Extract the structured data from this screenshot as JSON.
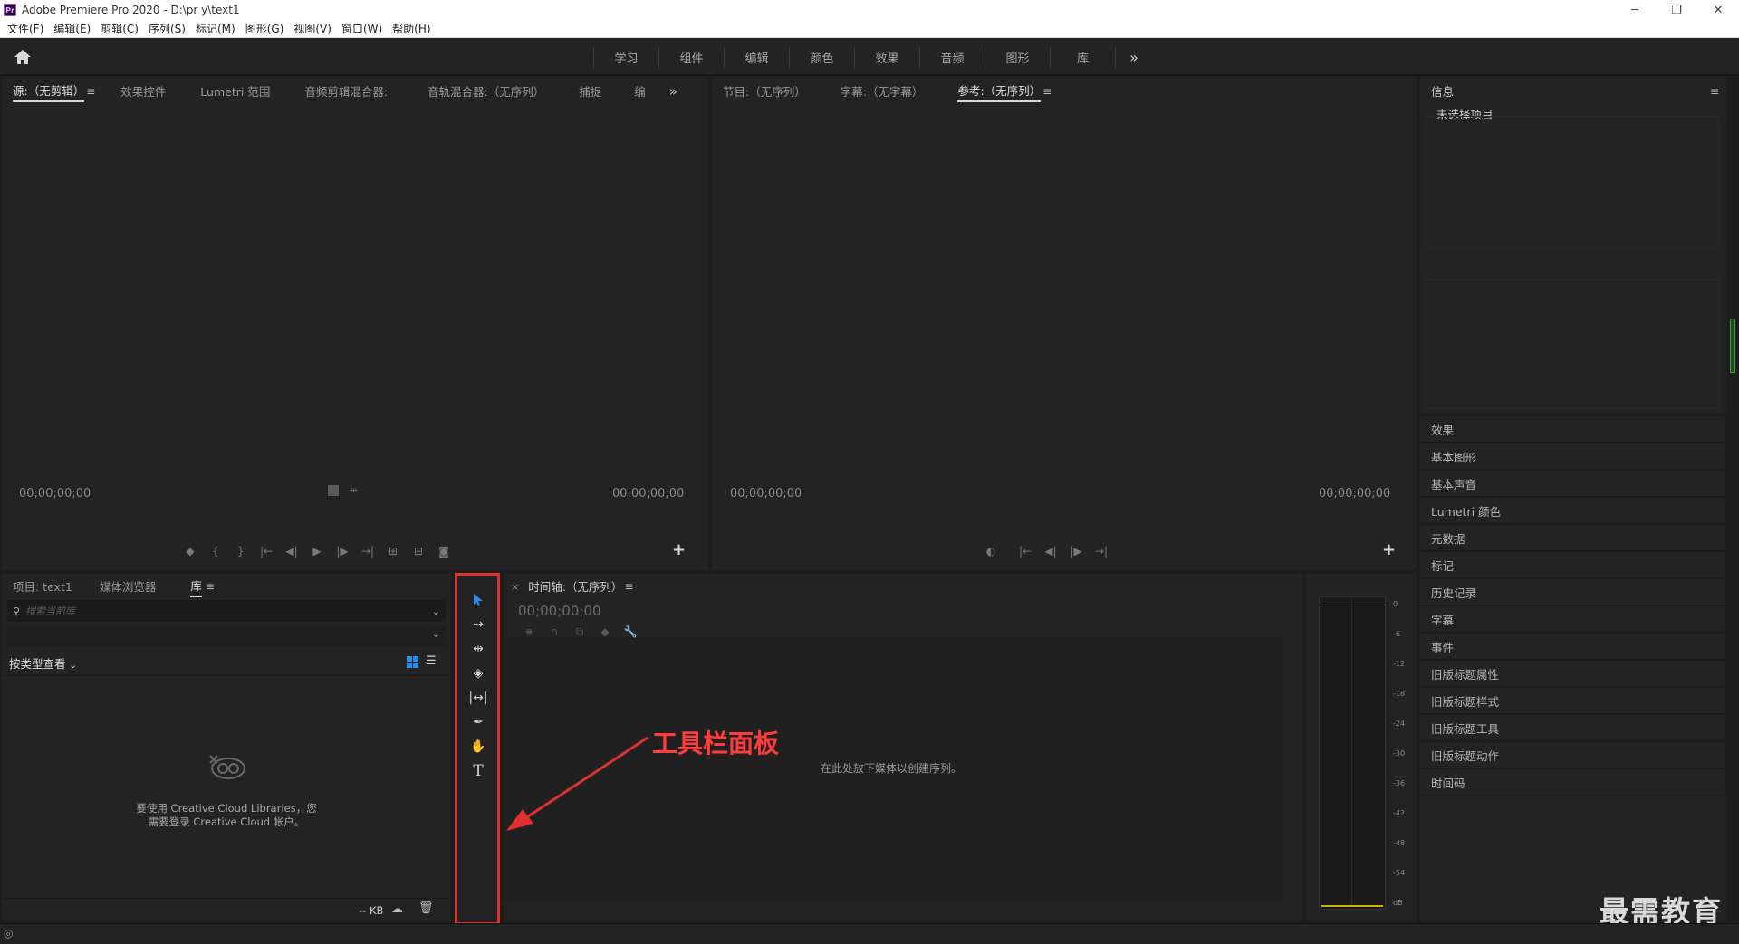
{
  "window": {
    "app_icon": "Pr",
    "title": "Adobe Premiere Pro 2020 - D:\\pr y\\text1",
    "minimize": "─",
    "restore": "❐",
    "close": "✕"
  },
  "menubar": [
    "文件(F)",
    "编辑(E)",
    "剪辑(C)",
    "序列(S)",
    "标记(M)",
    "图形(G)",
    "视图(V)",
    "窗口(W)",
    "帮助(H)"
  ],
  "workspace": {
    "tabs": [
      "学习",
      "组件",
      "编辑",
      "颜色",
      "效果",
      "音频",
      "图形",
      "库"
    ],
    "more": "»"
  },
  "source_panel": {
    "tabs": [
      "源:（无剪辑）",
      "效果控件",
      "Lumetri 范围",
      "音频剪辑混合器:",
      "音轨混合器:（无序列）",
      "捕捉",
      "编"
    ],
    "active_menu": "≡",
    "more": "»",
    "timecode_left": "00;00;00;00",
    "timecode_right": "00;00;00;00"
  },
  "program_panel": {
    "tabs": [
      "节目:（无序列）",
      "字幕:（无字幕）",
      "参考:（无序列）"
    ],
    "active_menu": "≡",
    "timecode_left": "00;00;00;00",
    "timecode_right": "00;00;00;00"
  },
  "info_panel": {
    "title": "信息",
    "menu": "≡",
    "no_selection": "未选择项目",
    "items": [
      "效果",
      "基本图形",
      "基本声音",
      "Lumetri 颜色",
      "元数据",
      "标记",
      "历史记录",
      "字幕",
      "事件",
      "旧版标题属性",
      "旧版标题样式",
      "旧版标题工具",
      "旧版标题动作",
      "时间码"
    ]
  },
  "project_panel": {
    "tabs": [
      "项目: text1",
      "媒体浏览器",
      "库"
    ],
    "active_menu": "≡",
    "search_placeholder": "搜索当前库",
    "view_by": "按类型查看",
    "cc_message_line1": "要使用 Creative Cloud Libraries，您",
    "cc_message_line2": "需要登录 Creative Cloud 帐户。",
    "size": "-- KB"
  },
  "timeline_panel": {
    "close": "×",
    "title": "时间轴:（无序列）",
    "menu": "≡",
    "timecode": "00;00;00;00",
    "drop_message": "在此处放下媒体以创建序列。"
  },
  "audio_meter": {
    "scale": [
      "0",
      "-6",
      "-12",
      "-18",
      "-24",
      "-30",
      "-36",
      "-42",
      "-48",
      "-54",
      "dB"
    ]
  },
  "annotation": {
    "label": "工具栏面板",
    "color": "#e03131"
  },
  "watermark": "最需教育",
  "colors": {
    "accent_blue": "#2d8ceb",
    "annotation_red": "#e03131"
  }
}
